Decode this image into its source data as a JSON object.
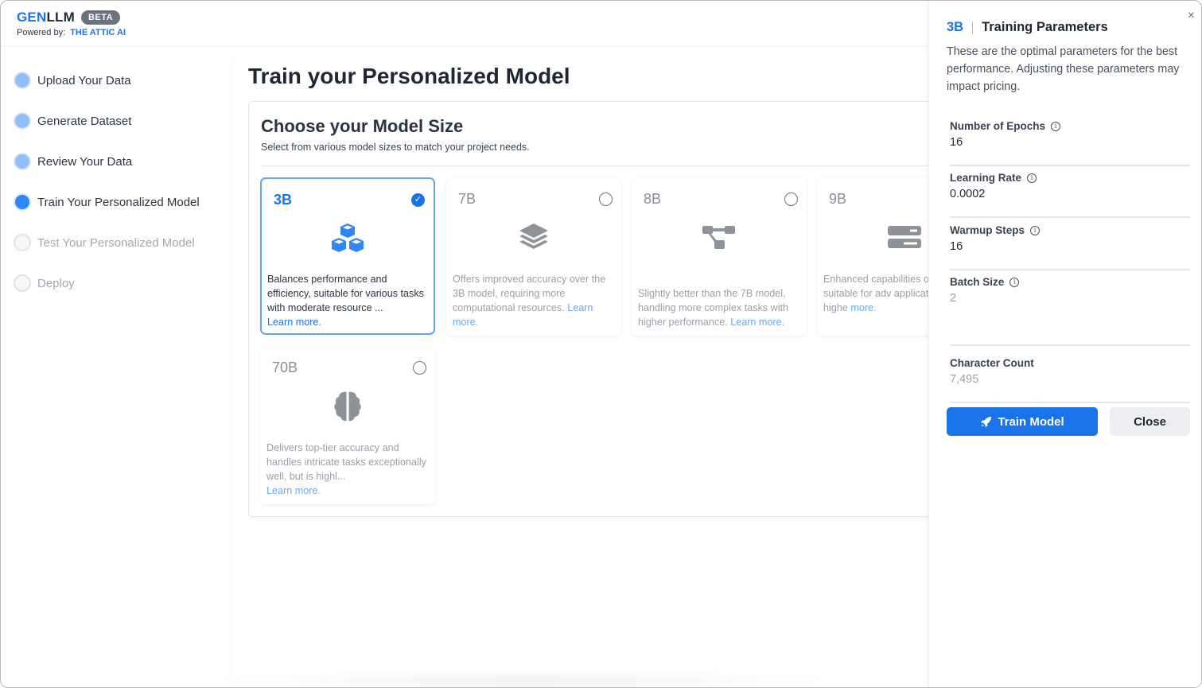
{
  "header": {
    "logo_part1": "GEN",
    "logo_part2": "LLM",
    "badge": "BETA",
    "powered_by_label": "Powered by:",
    "powered_by_brand": "THE ATTIC AI"
  },
  "sidebar": {
    "steps": [
      {
        "label": "Upload Your Data",
        "state": "done"
      },
      {
        "label": "Generate Dataset",
        "state": "done"
      },
      {
        "label": "Review Your Data",
        "state": "done"
      },
      {
        "label": "Train Your Personalized Model",
        "state": "active"
      },
      {
        "label": "Test Your Personalized Model",
        "state": "todo"
      },
      {
        "label": "Deploy",
        "state": "todo"
      }
    ]
  },
  "main": {
    "title": "Train your Personalized Model",
    "panel_title": "Choose your Model Size",
    "panel_subtitle": "Select from various model sizes to match your project needs.",
    "learn_more": "Learn more.",
    "cards": [
      {
        "size": "3B",
        "icon": "cubes-icon",
        "selected": true,
        "desc": "Balances performance and efficiency, suitable for various tasks with moderate resource ...",
        "learn": "Learn more."
      },
      {
        "size": "7B",
        "icon": "layer-stack-icon",
        "selected": false,
        "desc": "Offers improved accuracy over the 3B model, requiring more computational resources.",
        "learn": "Learn more."
      },
      {
        "size": "8B",
        "icon": "diagram-nodes-icon",
        "selected": false,
        "desc": "Slightly better than the 7B model, handling more complex tasks with higher performance.",
        "learn": "Learn more."
      },
      {
        "size": "9B",
        "icon": "server-icon",
        "selected": false,
        "desc": "Enhanced capabilities o model, suitable for adv applications with highe",
        "learn": "more."
      },
      {
        "size": "70B",
        "icon": "brain-icon",
        "selected": false,
        "desc": "Delivers top-tier accuracy and handles intricate tasks exceptionally well, but is highl...",
        "learn": "Learn more."
      }
    ]
  },
  "drawer": {
    "selected_size": "3B",
    "title": "Training Parameters",
    "description": "These are the optimal parameters for the best performance. Adjusting these parameters may impact pricing.",
    "fields": [
      {
        "label": "Number of Epochs",
        "value": "16",
        "info": true
      },
      {
        "label": "Learning Rate",
        "value": "0.0002",
        "info": true
      },
      {
        "label": "Warmup Steps",
        "value": "16",
        "info": true
      },
      {
        "label": "Batch Size",
        "value": "2",
        "info": true
      },
      {
        "label": "Character Count",
        "value": "7,495",
        "info": false
      }
    ],
    "train_button": "Train Model",
    "close_button": "Close",
    "close_icon": "×"
  },
  "colors": {
    "accent": "#1a73e8",
    "step_done": "#8fc0fb",
    "step_active": "#2f86f6"
  }
}
